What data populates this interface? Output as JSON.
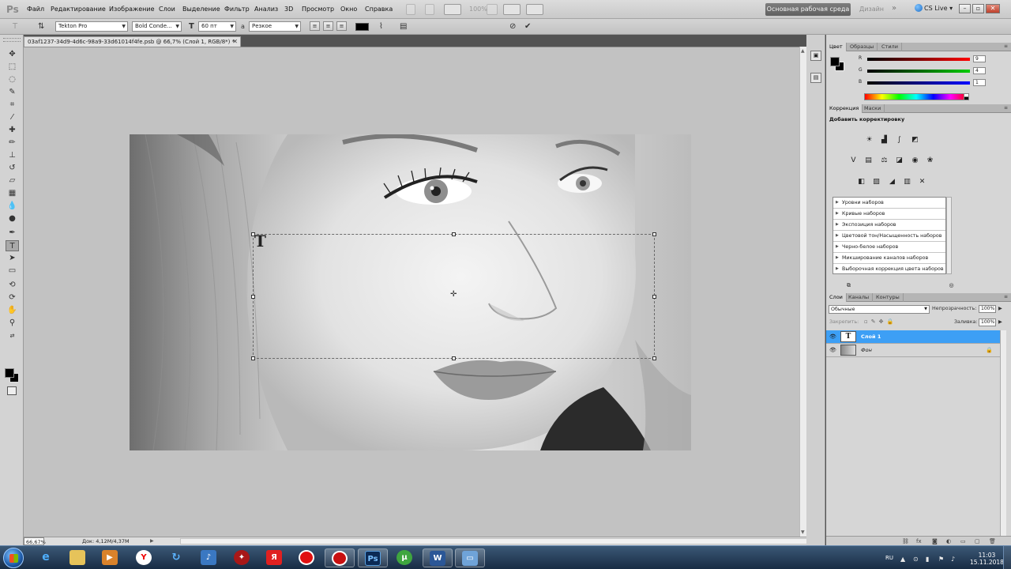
{
  "app": {
    "logo": "Ps",
    "menu": [
      "Файл",
      "Редактирование",
      "Изображение",
      "Слои",
      "Выделение",
      "Фильтр",
      "Анализ",
      "3D",
      "Просмотр",
      "Окно",
      "Справка"
    ],
    "zoom_readout": "100%",
    "workspace": "Основная рабочая среда",
    "design": "Дизайн",
    "cslive": "CS Live"
  },
  "options_bar": {
    "font_family": "Tekton Pro",
    "font_style": "Bold Conde...",
    "font_size": "60 пт",
    "aa_icon_label": "a",
    "antialias": "Резкое"
  },
  "document": {
    "tab_title": "03af1237-34d9-4d6c-98a9-33d61014f4fe.psb @ 66,7% (Слой 1, RGB/8*) *",
    "status_zoom": "66,67%",
    "status_doc": "Док: 4,12M/4,37M"
  },
  "panels": {
    "color_tabs": [
      "Цвет",
      "Образцы",
      "Стили"
    ],
    "rgb": [
      {
        "label": "R",
        "value": "9",
        "color": "#e02020"
      },
      {
        "label": "G",
        "value": "4",
        "color": "#20a040"
      },
      {
        "label": "B",
        "value": "1",
        "color": "#2040d0"
      }
    ],
    "adj_tabs": [
      "Коррекция",
      "Маски"
    ],
    "adj_title": "Добавить корректировку",
    "presets": [
      "Уровни наборов",
      "Кривые наборов",
      "Экспозиция наборов",
      "Цветовой тон/Насыщенность наборов",
      "Черно-белое наборов",
      "Микширование каналов наборов",
      "Выборочная коррекция цвета наборов"
    ],
    "layer_tabs": [
      "Слои",
      "Каналы",
      "Контуры"
    ],
    "blend_mode": "Обычные",
    "opacity_label": "Непрозрачность:",
    "opacity_value": "100%",
    "lock_label": "Закрепить:",
    "fill_label": "Заливка:",
    "fill_value": "100%",
    "layers": [
      {
        "name": "Слой 1",
        "thumb": "T",
        "selected": true
      },
      {
        "name": "Фон",
        "thumb": "",
        "selected": false
      }
    ]
  },
  "taskbar": {
    "lang": "RU",
    "time": "11:03",
    "date": "15.11.2018"
  }
}
